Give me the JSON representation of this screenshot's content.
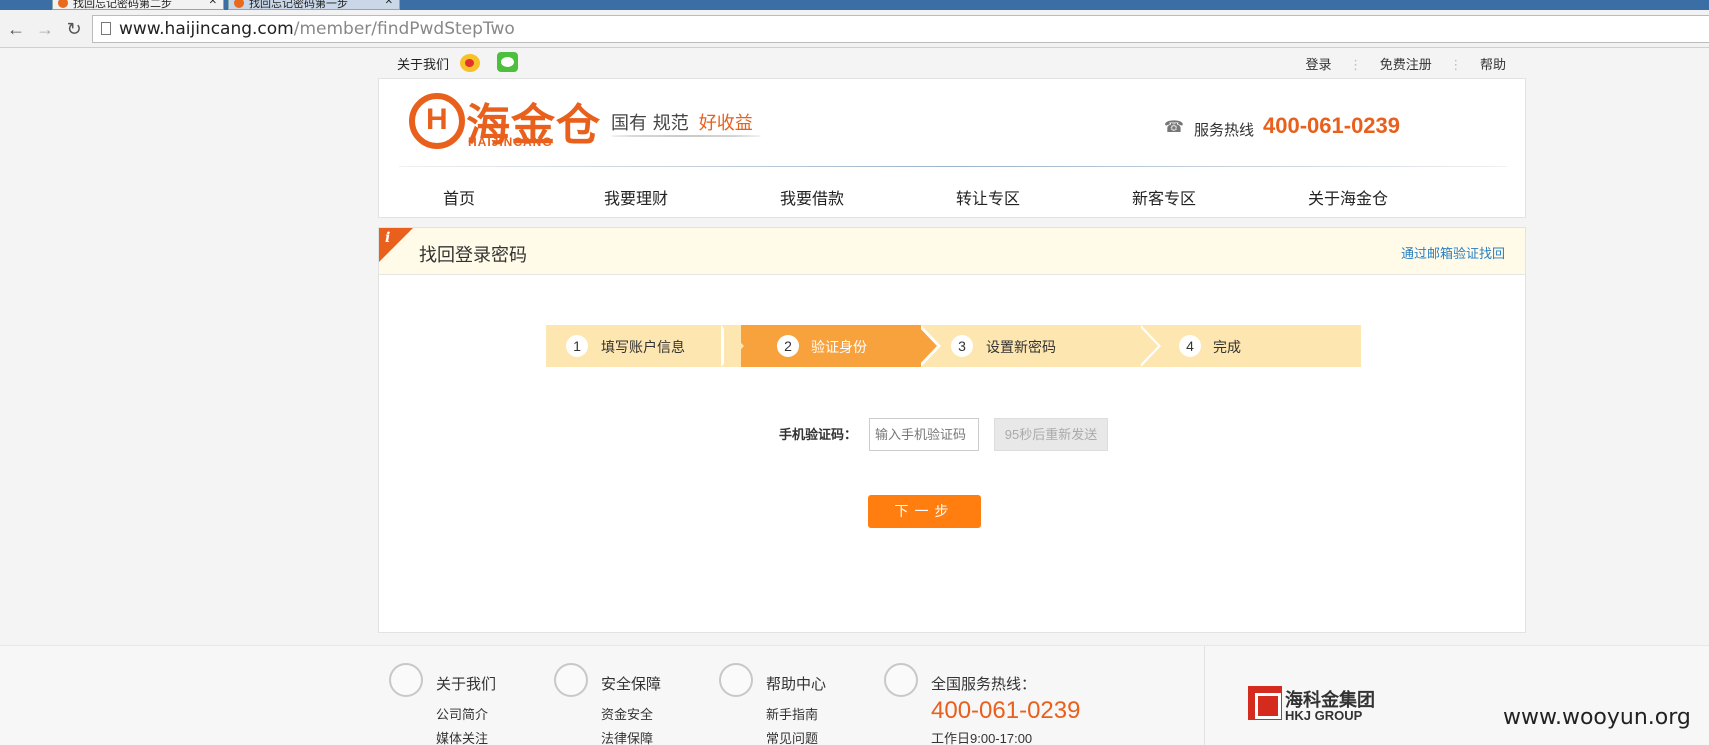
{
  "browser": {
    "tabs": [
      {
        "title": "找回忘记密码第二步"
      },
      {
        "title": "找回忘记密码第一步"
      }
    ],
    "url_host": "www.haijincang.com",
    "url_path": "/member/findPwdStepTwo"
  },
  "topbar": {
    "about": "关于我们",
    "login": "登录",
    "register": "免费注册",
    "help": "帮助",
    "separator": "⋮"
  },
  "header": {
    "logo_cn": "海金仓",
    "logo_en": "HAIJINCANG",
    "slogan": "国有 规范",
    "slogan_highlight": "好收益",
    "hotline_label": "服务热线",
    "hotline_number": "400-061-0239"
  },
  "nav": {
    "items": [
      "首页",
      "我要理财",
      "我要借款",
      "转让专区",
      "新客专区",
      "关于海金仓"
    ]
  },
  "panel": {
    "info_glyph": "i",
    "title": "找回登录密码",
    "email_link": "通过邮箱验证找回"
  },
  "steps": [
    {
      "num": "1",
      "label": "填写账户信息"
    },
    {
      "num": "2",
      "label": "验证身份"
    },
    {
      "num": "3",
      "label": "设置新密码"
    },
    {
      "num": "4",
      "label": "完成"
    }
  ],
  "form": {
    "code_label": "手机验证码：",
    "code_placeholder": "输入手机验证码",
    "resend_label": "95秒后重新发送",
    "next_label": "下一步"
  },
  "footer": {
    "about": {
      "title": "关于我们",
      "links": [
        "公司简介",
        "媒体关注"
      ]
    },
    "security": {
      "title": "安全保障",
      "links": [
        "资金安全",
        "法律保障"
      ]
    },
    "help": {
      "title": "帮助中心",
      "links": [
        "新手指南",
        "常见问题"
      ]
    },
    "service": {
      "title": "全国服务热线：",
      "number": "400-061-0239",
      "hours": "工作日9:00-17:00"
    },
    "group_cn": "海科金集团",
    "group_en": "HKJ GROUP"
  },
  "watermark": "www.wooyun.org",
  "colors": {
    "brand_orange": "#e8601c",
    "step_active": "#f7a23c",
    "step_inactive": "#fde6b0",
    "link_blue": "#2a7fc4"
  }
}
